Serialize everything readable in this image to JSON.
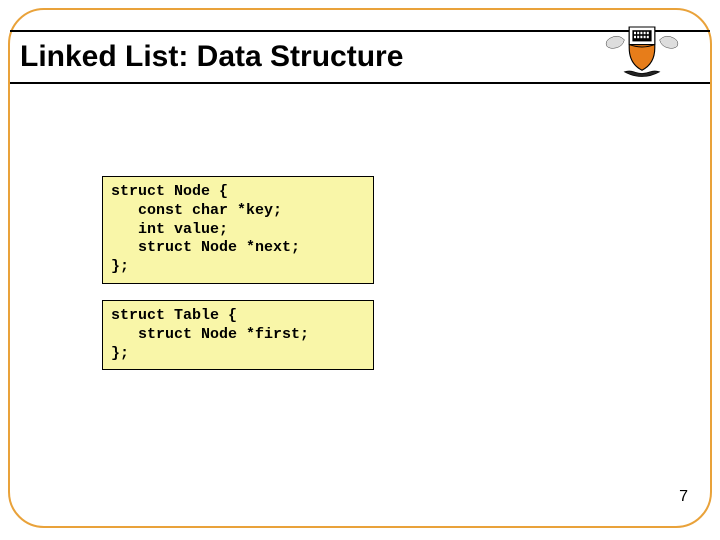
{
  "slide": {
    "title": "Linked List: Data Structure",
    "page_number": "7"
  },
  "code_block_1": "struct Node {\n   const char *key;\n   int value;\n   struct Node *next;\n};",
  "code_block_2": "struct Table {\n   struct Node *first;\n};"
}
